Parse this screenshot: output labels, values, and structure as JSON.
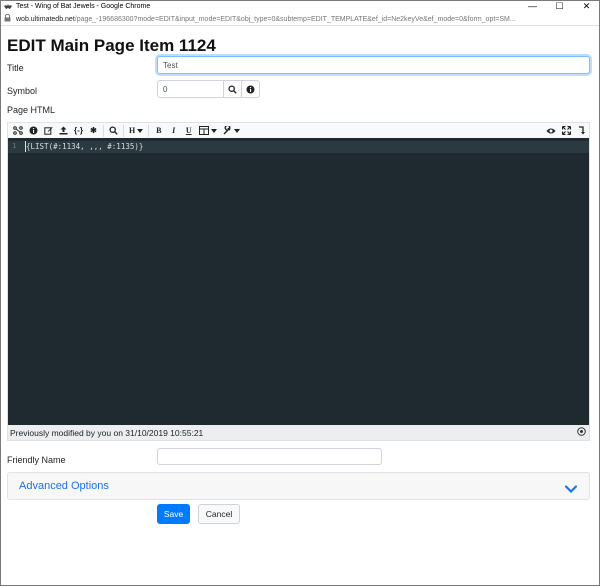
{
  "window": {
    "title": "Test - Wing of Bat Jewels - Google Chrome",
    "minimize_glyph": "—",
    "maximize_glyph": "☐",
    "close_glyph": "✕"
  },
  "address": {
    "host": "wob.ultimatedb.net",
    "rest": "/page_-196686300?mode=EDIT&input_mode=EDIT&obj_type=0&subtemp=EDIT_TEMPLATE&ef_id=Ne2keyVe&ef_mode=0&form_opt=SM..."
  },
  "page": {
    "heading": "EDIT Main Page Item 1124"
  },
  "form": {
    "title_label": "Title",
    "title_value": "Test",
    "symbol_label": "Symbol",
    "symbol_value": "0",
    "page_html_label": "Page HTML",
    "friendly_name_label": "Friendly Name",
    "friendly_name_value": ""
  },
  "toolbar": {
    "heading_label": "H",
    "bold_label": "B",
    "italic_label": "I",
    "underline_label": "U",
    "braces_label": "{-}",
    "asterisk_label": "✱"
  },
  "editor": {
    "line_number": "1",
    "code": "{LIST(#:1134, ,,, #:1135)}"
  },
  "status": {
    "modified_text": "Previously modified by you on 31/10/2019 10:55:21"
  },
  "accordion": {
    "label": "Advanced Options"
  },
  "buttons": {
    "save": "Save",
    "cancel": "Cancel"
  },
  "colors": {
    "accent": "#007bff",
    "editor_bg": "#1e2a2f",
    "link_blue": "#1a73e8"
  }
}
